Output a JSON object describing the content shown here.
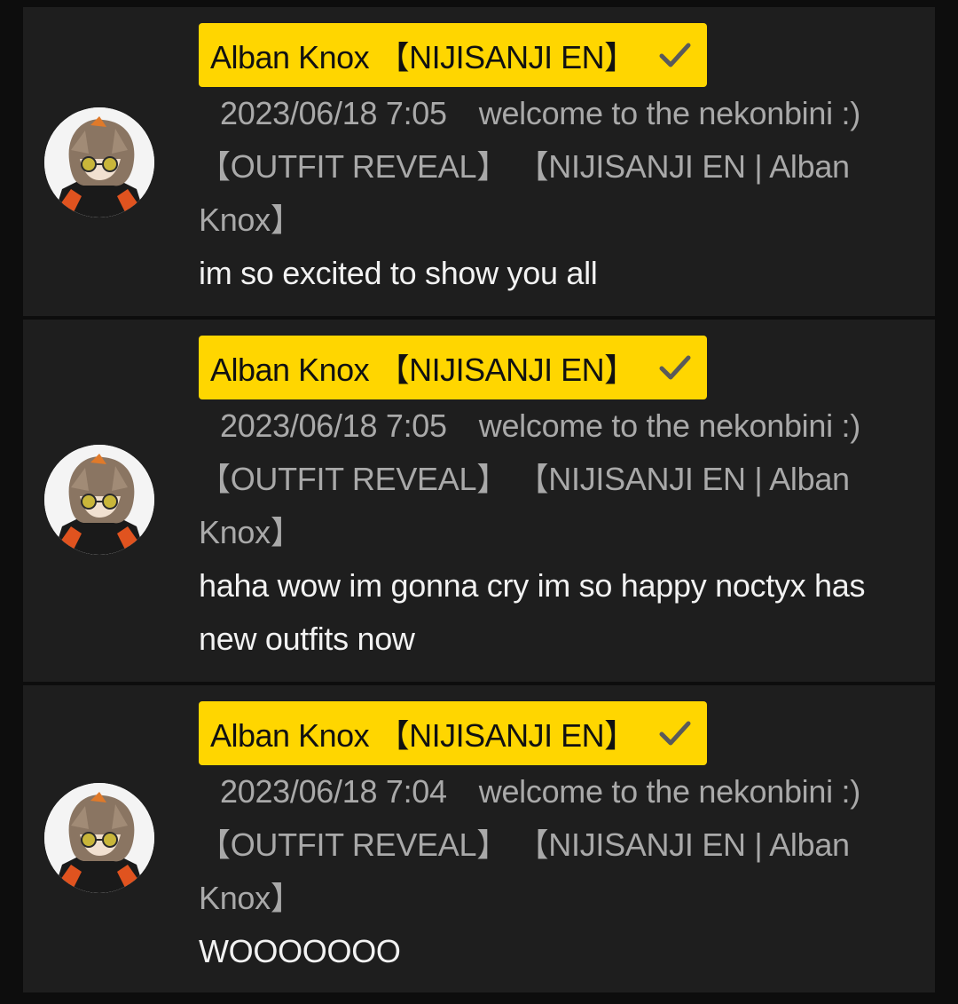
{
  "colors": {
    "background": "#0d0d0d",
    "card": "#1e1e1e",
    "badge": "#ffd600",
    "meta_text": "#a9a9a9",
    "message_text": "#f2f2f2"
  },
  "comments": [
    {
      "author": "Alban Knox 【NIJISANJI EN】",
      "verified_icon": "checkmark-icon",
      "timestamp": "2023/06/18 7:05",
      "video_title": "welcome to the nekonbini :)【OUTFIT REVEAL】 【NIJISANJI EN | Alban Knox】",
      "message": "im so excited to show you all"
    },
    {
      "author": "Alban Knox 【NIJISANJI EN】",
      "verified_icon": "checkmark-icon",
      "timestamp": "2023/06/18 7:05",
      "video_title": "welcome to the nekonbini :)【OUTFIT REVEAL】 【NIJISANJI EN | Alban Knox】",
      "message": "haha wow im gonna cry im so happy noctyx has new outfits now"
    },
    {
      "author": "Alban Knox 【NIJISANJI EN】",
      "verified_icon": "checkmark-icon",
      "timestamp": "2023/06/18 7:04",
      "video_title": "welcome to the nekonbini :)【OUTFIT REVEAL】 【NIJISANJI EN | Alban Knox】",
      "message": "WOOOOOOO"
    }
  ]
}
